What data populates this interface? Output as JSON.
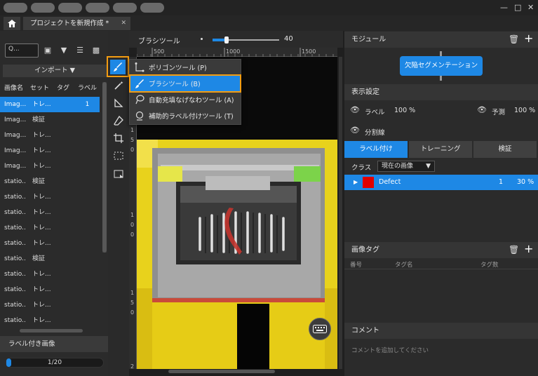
{
  "tab": {
    "title": "プロジェクトを新規作成 *"
  },
  "left": {
    "search_placeholder": "Q...",
    "import_label": "インポート",
    "columns": [
      "画像名",
      "セット",
      "タグ",
      "ラベル"
    ],
    "rows": [
      {
        "name": "Imag...",
        "set": "トレ...",
        "tag": "",
        "label": "1",
        "selected": true
      },
      {
        "name": "Imag...",
        "set": "検証",
        "tag": "",
        "label": ""
      },
      {
        "name": "Imag...",
        "set": "トレ...",
        "tag": "",
        "label": ""
      },
      {
        "name": "Imag...",
        "set": "トレ...",
        "tag": "",
        "label": ""
      },
      {
        "name": "Imag...",
        "set": "トレ...",
        "tag": "",
        "label": ""
      },
      {
        "name": "statio...",
        "set": "検証",
        "tag": "",
        "label": ""
      },
      {
        "name": "statio...",
        "set": "トレ...",
        "tag": "",
        "label": ""
      },
      {
        "name": "statio...",
        "set": "トレ...",
        "tag": "",
        "label": ""
      },
      {
        "name": "statio...",
        "set": "トレ...",
        "tag": "",
        "label": ""
      },
      {
        "name": "statio...",
        "set": "トレ...",
        "tag": "",
        "label": ""
      },
      {
        "name": "statio...",
        "set": "検証",
        "tag": "",
        "label": ""
      },
      {
        "name": "statio...",
        "set": "トレ...",
        "tag": "",
        "label": ""
      },
      {
        "name": "statio...",
        "set": "トレ...",
        "tag": "",
        "label": ""
      },
      {
        "name": "statio...",
        "set": "トレ...",
        "tag": "",
        "label": ""
      },
      {
        "name": "statio...",
        "set": "トレ...",
        "tag": "",
        "label": ""
      }
    ],
    "labeled_header": "ラベル付き画像",
    "progress_text": "1/20",
    "progress_fraction": 0.05
  },
  "toolbar": {
    "brush_label": "ブラシツール",
    "brush_size": "40",
    "ruler_marks": [
      "500",
      "1000",
      "1500"
    ],
    "vruler_marks": [
      "1",
      "5",
      "0",
      "1",
      "0",
      "0",
      "1",
      "5",
      "0",
      "2"
    ]
  },
  "menu": {
    "items": [
      {
        "label": "ポリゴンツール (P)"
      },
      {
        "label": "ブラシツール (B)"
      },
      {
        "label": "自動充填なげなわツール (A)"
      },
      {
        "label": "補助的ラベル付けツール (T)"
      }
    ]
  },
  "right": {
    "module_header": "モジュール",
    "module_button": "欠陥セグメンテーション",
    "display_header": "表示設定",
    "label_toggle": "ラベル",
    "label_pct": "100 %",
    "predict_toggle": "予測",
    "predict_pct": "100 %",
    "divider_toggle": "分割線",
    "tabs": [
      "ラベル付け",
      "トレーニング",
      "検証"
    ],
    "class_label": "クラス",
    "class_select": "現在の画像",
    "defect": {
      "name": "Defect",
      "count": "1",
      "pct": "30 %",
      "color": "#e00000"
    },
    "tag_header": "画像タグ",
    "tag_columns": [
      "番号",
      "タグ名",
      "タグ数"
    ],
    "comment_header": "コメント",
    "comment_placeholder": "コメントを追加してください"
  },
  "colors": {
    "accent": "#1e88e5",
    "highlight": "#f39c12"
  }
}
